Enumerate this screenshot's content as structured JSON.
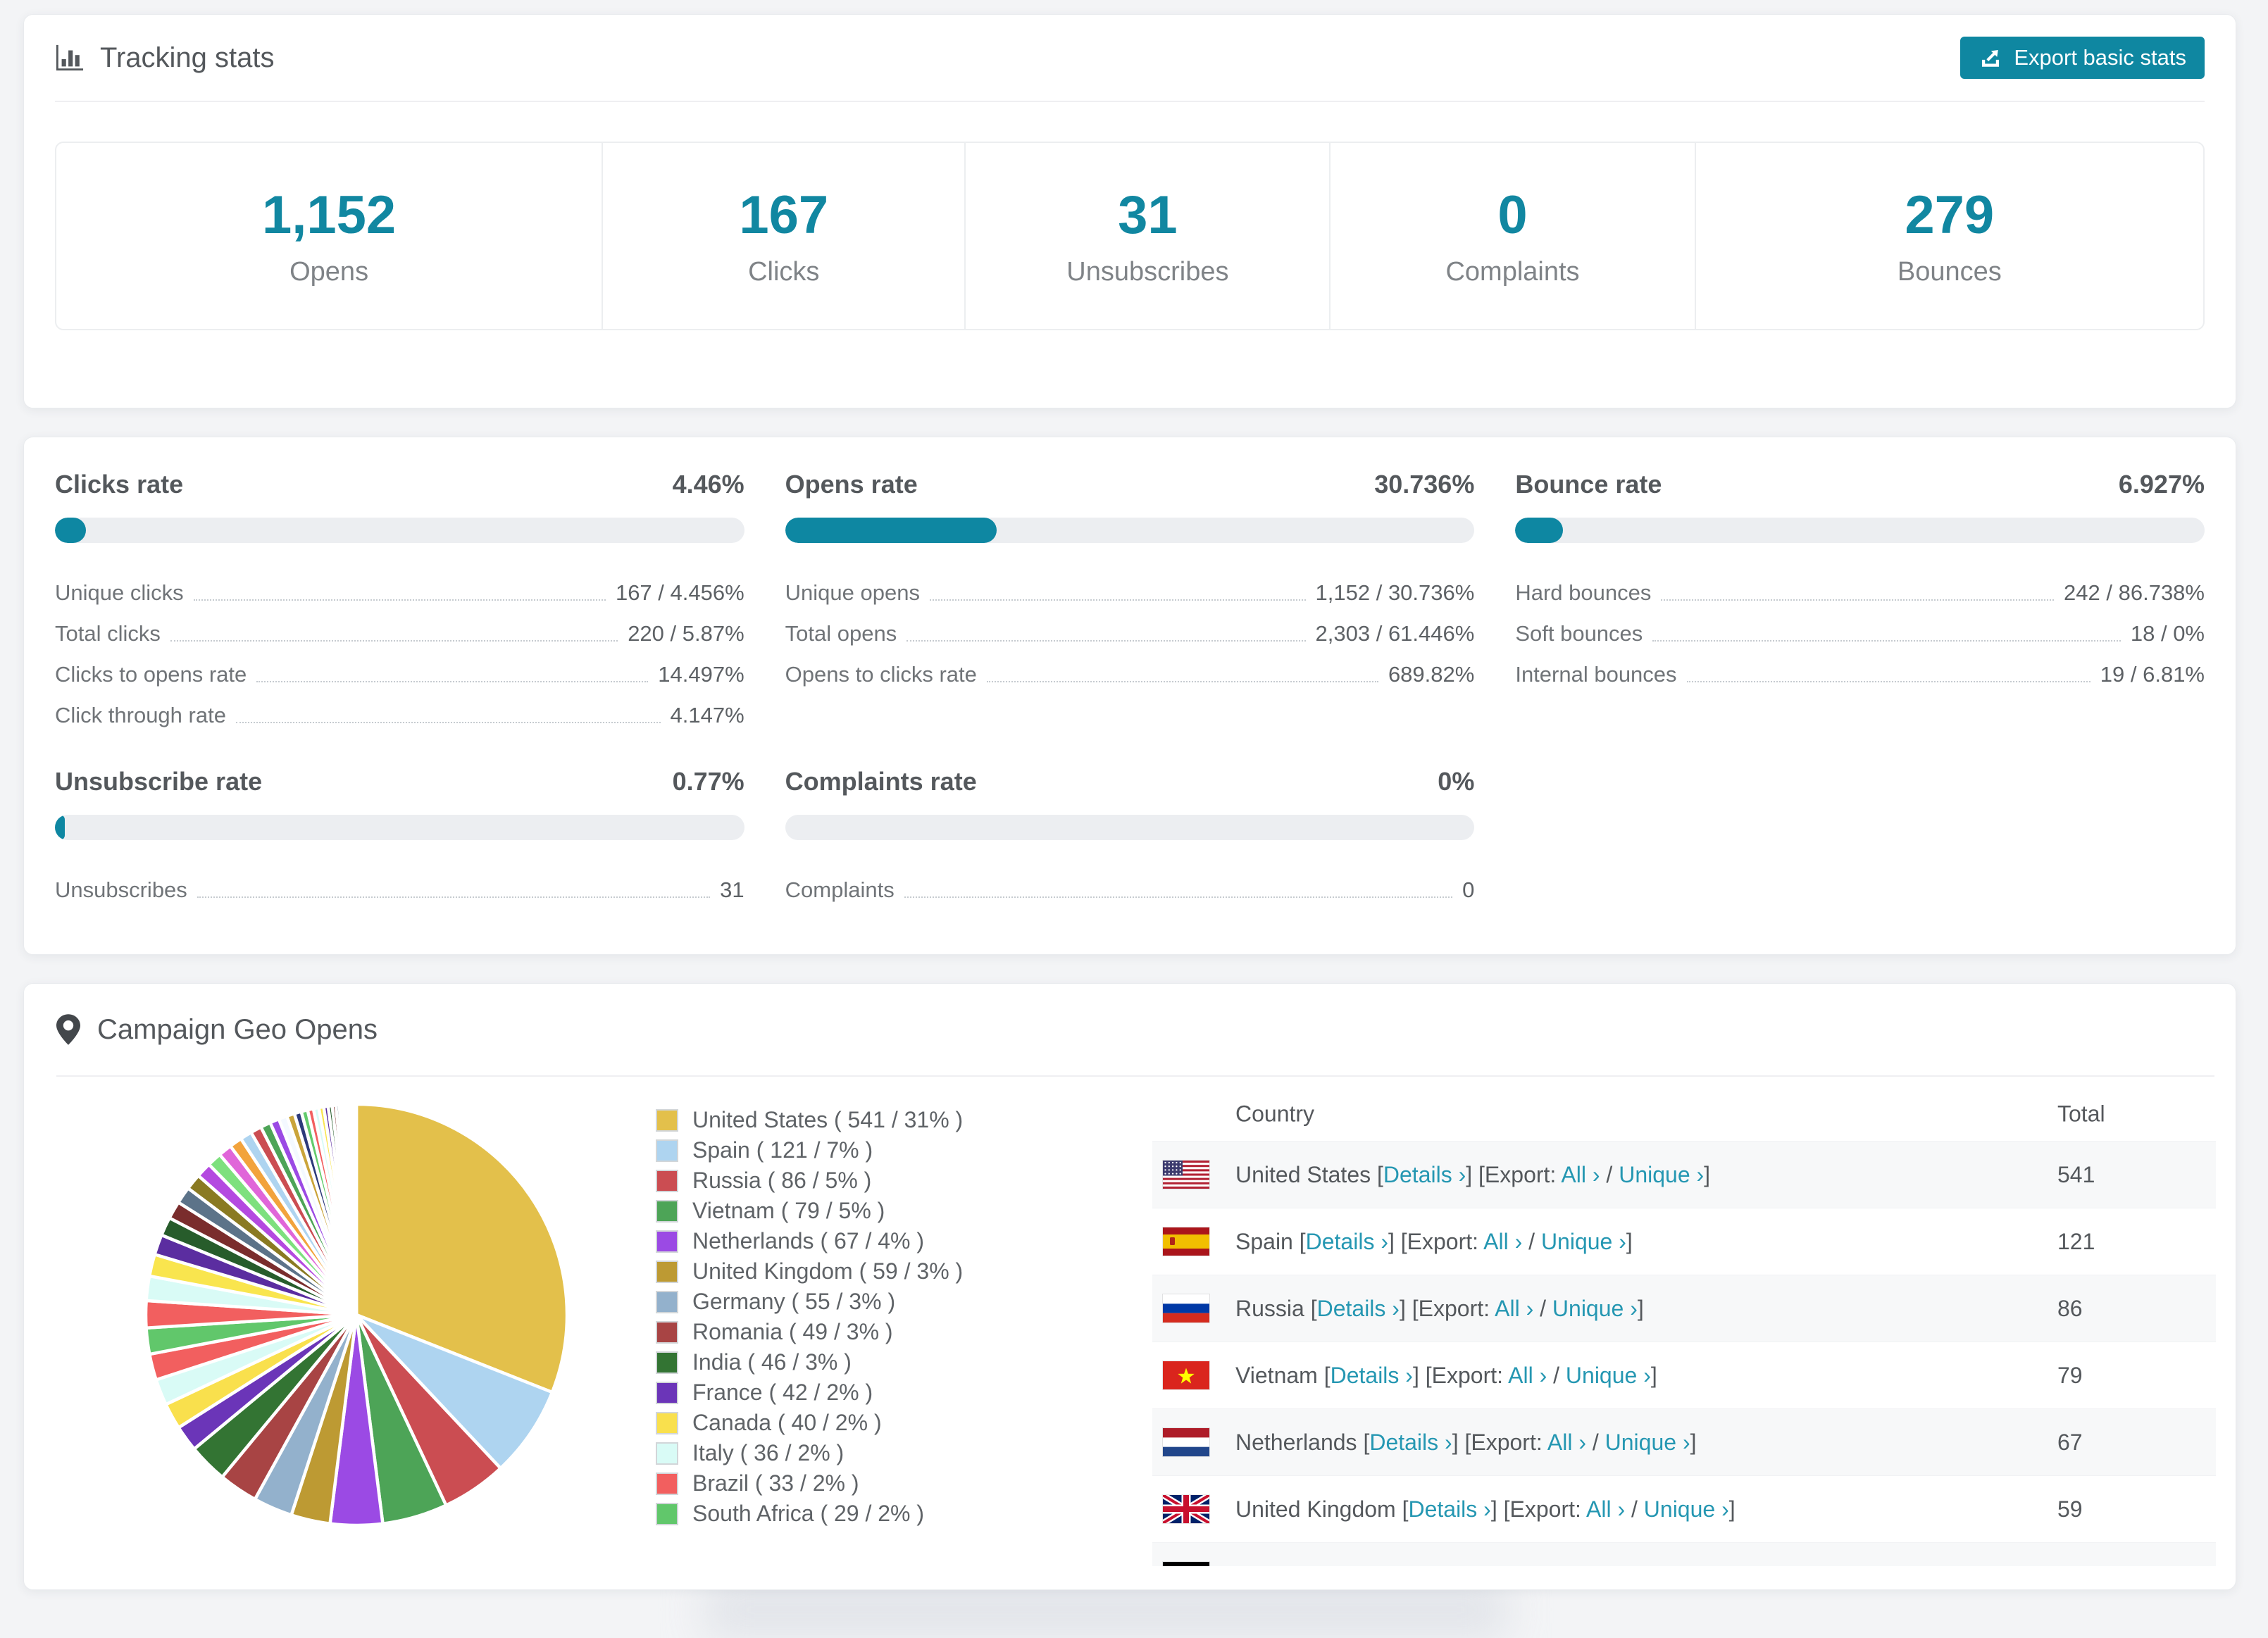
{
  "colors": {
    "accent": "#0f87a1",
    "link": "#2597b2",
    "stat_number": "#1187a1",
    "bar_track": "#eceef1"
  },
  "tracking": {
    "title": "Tracking stats",
    "export_button_label": "Export basic stats",
    "stats": [
      {
        "value": "1,152",
        "label": "Opens"
      },
      {
        "value": "167",
        "label": "Clicks"
      },
      {
        "value": "31",
        "label": "Unsubscribes"
      },
      {
        "value": "0",
        "label": "Complaints"
      },
      {
        "value": "279",
        "label": "Bounces"
      }
    ]
  },
  "rates": [
    {
      "title": "Clicks rate",
      "value": "4.46%",
      "pct": 4.46,
      "rows": [
        {
          "label": "Unique clicks",
          "value": "167 / 4.456%"
        },
        {
          "label": "Total clicks",
          "value": "220 / 5.87%"
        },
        {
          "label": "Clicks to opens rate",
          "value": "14.497%"
        },
        {
          "label": "Click through rate",
          "value": "4.147%"
        }
      ]
    },
    {
      "title": "Opens rate",
      "value": "30.736%",
      "pct": 30.736,
      "rows": [
        {
          "label": "Unique opens",
          "value": "1,152 / 30.736%"
        },
        {
          "label": "Total opens",
          "value": "2,303 / 61.446%"
        },
        {
          "label": "Opens to clicks rate",
          "value": "689.82%"
        }
      ]
    },
    {
      "title": "Bounce rate",
      "value": "6.927%",
      "pct": 6.927,
      "rows": [
        {
          "label": "Hard bounces",
          "value": "242 / 86.738%"
        },
        {
          "label": "Soft bounces",
          "value": "18 / 0%"
        },
        {
          "label": "Internal bounces",
          "value": "19 / 6.81%"
        }
      ]
    },
    {
      "title": "Unsubscribe rate",
      "value": "0.77%",
      "pct": 0.77,
      "rows": [
        {
          "label": "Unsubscribes",
          "value": "31"
        }
      ]
    },
    {
      "title": "Complaints rate",
      "value": "0%",
      "pct": 0,
      "rows": [
        {
          "label": "Complaints",
          "value": "0"
        }
      ]
    }
  ],
  "geo": {
    "title": "Campaign Geo Opens",
    "table": {
      "headers": [
        "Country",
        "Total"
      ],
      "labels": {
        "details": "Details ›",
        "export": "Export:",
        "all": "All ›",
        "unique": "Unique ›"
      },
      "rows": [
        {
          "country": "United States",
          "flag": "us",
          "total": "541"
        },
        {
          "country": "Spain",
          "flag": "es",
          "total": "121"
        },
        {
          "country": "Russia",
          "flag": "ru",
          "total": "86"
        },
        {
          "country": "Vietnam",
          "flag": "vn",
          "total": "79"
        },
        {
          "country": "Netherlands",
          "flag": "nl",
          "total": "67"
        },
        {
          "country": "United Kingdom",
          "flag": "gb",
          "total": "59"
        }
      ],
      "partial_row": {
        "flag": "de"
      }
    }
  },
  "chart_data": {
    "type": "pie",
    "title": "Campaign Geo Opens",
    "legend_position": "right",
    "start_angle_deg": 0,
    "direction": "clockwise",
    "slices": [
      {
        "name": "United States",
        "count": 541,
        "pct": 31,
        "color": "#e3c04b"
      },
      {
        "name": "Spain",
        "count": 121,
        "pct": 7,
        "color": "#aed4f0"
      },
      {
        "name": "Russia",
        "count": 86,
        "pct": 5,
        "color": "#cb4d52"
      },
      {
        "name": "Vietnam",
        "count": 79,
        "pct": 5,
        "color": "#4da457"
      },
      {
        "name": "Netherlands",
        "count": 67,
        "pct": 4,
        "color": "#9b4ae4"
      },
      {
        "name": "United Kingdom",
        "count": 59,
        "pct": 3,
        "color": "#bd9a33"
      },
      {
        "name": "Germany",
        "count": 55,
        "pct": 3,
        "color": "#93b1cc"
      },
      {
        "name": "Romania",
        "count": 49,
        "pct": 3,
        "color": "#a84444"
      },
      {
        "name": "India",
        "count": 46,
        "pct": 3,
        "color": "#337433"
      },
      {
        "name": "France",
        "count": 42,
        "pct": 2,
        "color": "#6b35b8"
      },
      {
        "name": "Canada",
        "count": 40,
        "pct": 2,
        "color": "#f9e04d"
      },
      {
        "name": "Italy",
        "count": 36,
        "pct": 2,
        "color": "#d9fbf6"
      },
      {
        "name": "Brazil",
        "count": 33,
        "pct": 2,
        "color": "#f25f5f"
      },
      {
        "name": "South Africa",
        "count": 29,
        "pct": 2,
        "color": "#61c76b"
      }
    ],
    "others_pct": 26,
    "others_slice_weights": [
      1.6,
      1.45,
      1.3,
      1.2,
      1.1,
      1.05,
      1.0,
      0.95,
      0.9,
      0.85,
      0.8,
      0.75,
      0.7,
      0.65,
      0.6,
      0.55,
      0.5,
      0.46,
      0.42,
      0.38,
      0.35,
      0.32,
      0.29,
      0.26,
      0.24,
      0.22,
      0.2,
      0.18,
      0.16,
      0.14,
      0.12,
      0.1,
      0.09,
      0.08,
      0.07,
      0.06
    ]
  }
}
